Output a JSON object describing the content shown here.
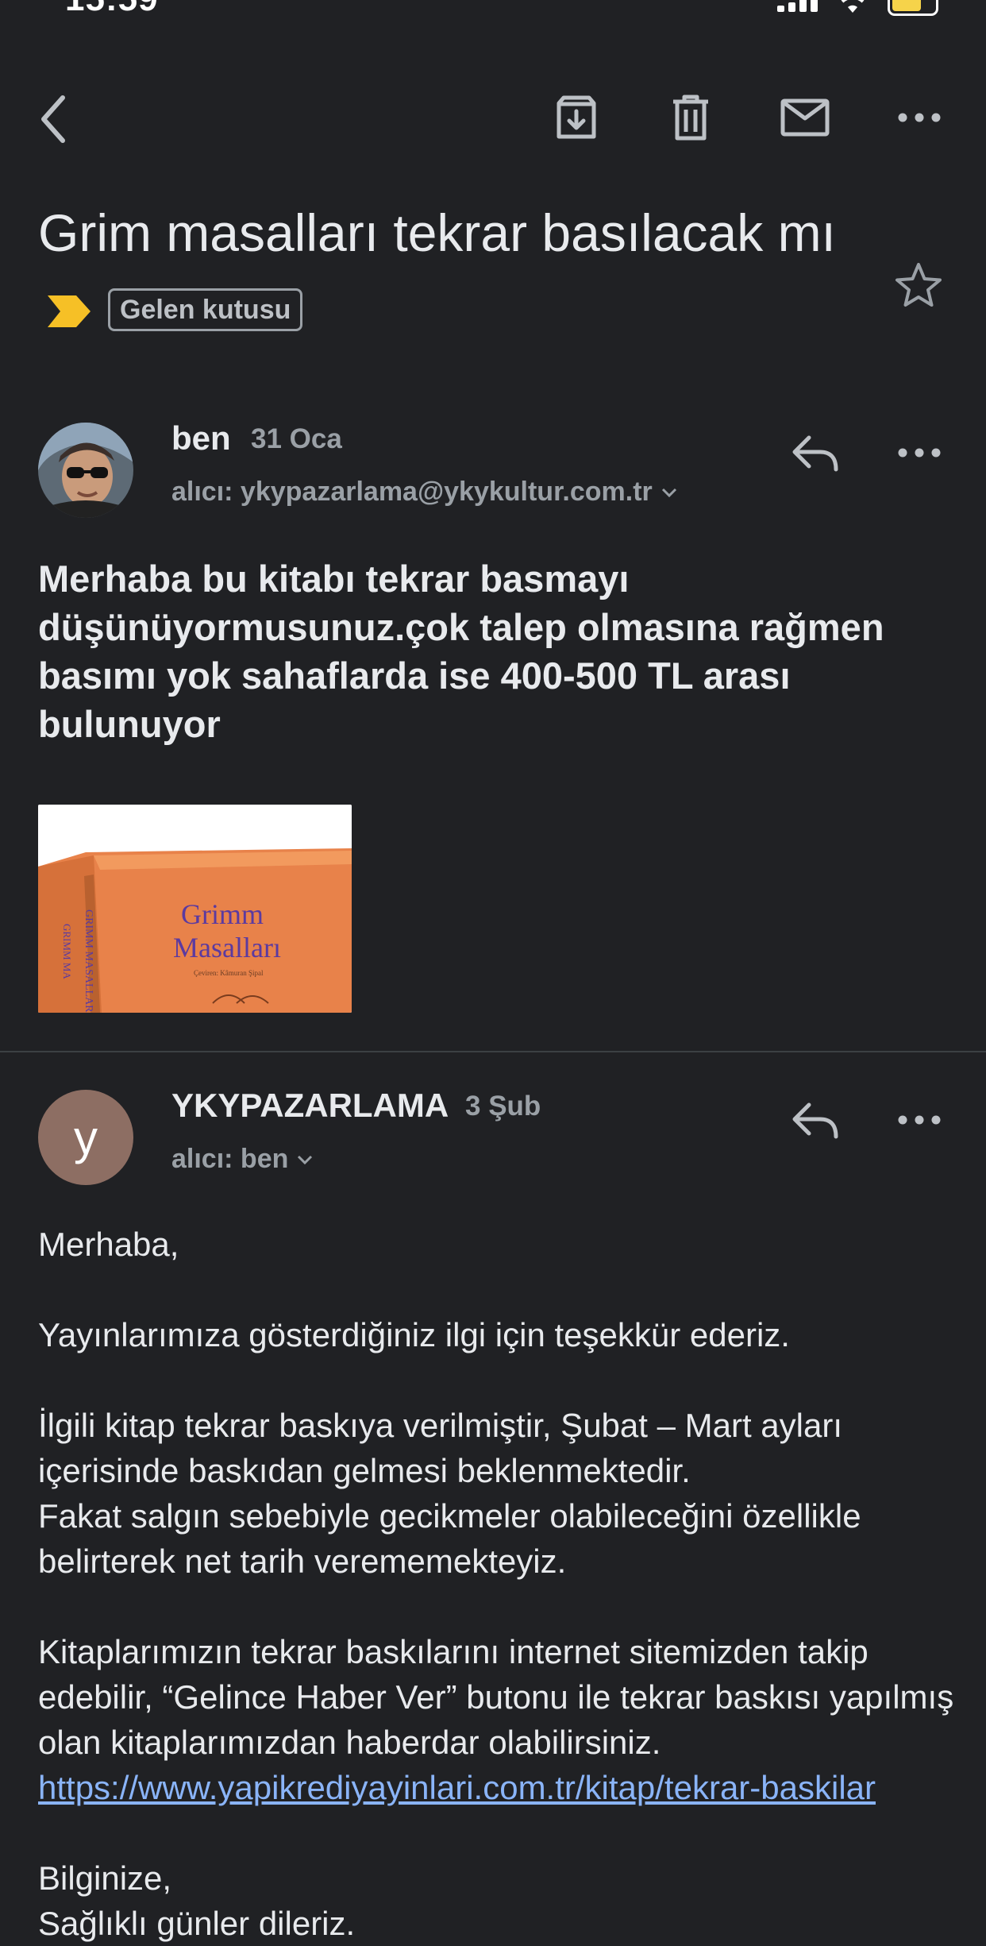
{
  "status_bar": {
    "time": "15:59"
  },
  "toolbar": {
    "back_icon": "chevron-left-icon",
    "archive_icon": "archive-icon",
    "delete_icon": "trash-icon",
    "mark_unread_icon": "mail-icon",
    "more_icon": "more-horizontal-icon"
  },
  "email": {
    "subject": "Grim masalları tekrar basılacak mı",
    "label": "Gelen kutusu",
    "importance_color": "#f6c026",
    "messages": [
      {
        "sender": "ben",
        "date": "31 Oca",
        "recipient": "alıcı: ykypazarlama@ykykultur.com.tr",
        "body": "Merhaba bu kitabı tekrar basmayı düşünüyormusunuz.çok talep olmasına rağmen basımı yok sahaflarda ise 400-500 TL arası bulunuyor",
        "attachment": {
          "title_line1": "Grimm",
          "title_line2": "Masalları",
          "subtitle": "Çeviren: Kâmuran Şipal",
          "spine_text": "GRIMM MASALLARI",
          "spine_text2": "GRIMM MA"
        }
      },
      {
        "sender": "YKYPAZARLAMA",
        "avatar_letter": "y",
        "avatar_color": "#8d6e63",
        "date": "3 Şub",
        "recipient": "alıcı: ben",
        "body": {
          "greeting": "Merhaba,",
          "p1": "Yayınlarımıza gösterdiğiniz ilgi için teşekkür ederiz.",
          "p2": "İlgili kitap tekrar baskıya verilmiştir, Şubat – Mart ayları içerisinde baskıdan gelmesi beklenmektedir.",
          "p3": "Fakat salgın sebebiyle gecikmeler olabileceğini özellikle belirterek net tarih verememekteyiz.",
          "p4": "Kitaplarımızın tekrar baskılarını internet sitemizden takip edebilir, “Gelince Haber Ver” butonu ile tekrar baskısı yapılmış olan kitaplarımızdan haberdar olabilirsiniz.",
          "link": "https://www.yapikrediyayinlari.com.tr/kitap/tekrar-baskilar",
          "closing": "Bilginize,",
          "closing2": "Sağlıklı günler dileriz."
        }
      }
    ]
  }
}
